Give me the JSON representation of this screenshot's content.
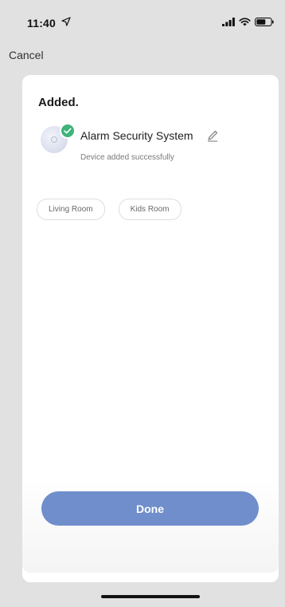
{
  "status_bar": {
    "time": "11:40",
    "icons": [
      "location-arrow-icon",
      "signal-icon",
      "wifi-icon",
      "battery-icon"
    ]
  },
  "nav": {
    "cancel_label": "Cancel"
  },
  "card": {
    "title": "Added.",
    "device": {
      "name": "Alarm Security System",
      "status": "Device added successfully",
      "icon": "alarm-device-icon",
      "badge_icon": "check-circle-icon",
      "edit_icon": "pencil-icon"
    },
    "rooms": [
      {
        "label": "Living Room"
      },
      {
        "label": "Kids Room"
      }
    ],
    "done_label": "Done"
  },
  "colors": {
    "background": "#e1e1e1",
    "card": "#ffffff",
    "accent_button": "#6f8ecb",
    "success_badge": "#3fb37a"
  }
}
